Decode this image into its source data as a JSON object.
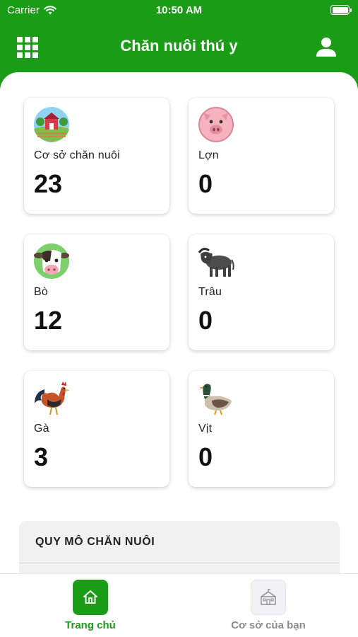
{
  "status_bar": {
    "carrier": "Carrier",
    "time": "10:50 AM"
  },
  "app_bar": {
    "title": "Chăn nuôi thú y",
    "menu_icon": "grid-icon",
    "profile_icon": "user-icon"
  },
  "stats": [
    {
      "label": "Cơ sở chăn nuôi",
      "count": "23",
      "icon": "farm-icon"
    },
    {
      "label": "Lợn",
      "count": "0",
      "icon": "pig-icon"
    },
    {
      "label": "Bò",
      "count": "12",
      "icon": "cow-icon"
    },
    {
      "label": "Trâu",
      "count": "0",
      "icon": "buffalo-icon"
    },
    {
      "label": "Gà",
      "count": "3",
      "icon": "rooster-icon"
    },
    {
      "label": "Vịt",
      "count": "0",
      "icon": "duck-icon"
    }
  ],
  "section": {
    "title": "QUY MÔ CHĂN NUÔI"
  },
  "tabs": [
    {
      "label": "Trang chủ",
      "icon": "home-icon",
      "active": true
    },
    {
      "label": "Cơ sở của bạn",
      "icon": "building-icon",
      "active": false
    }
  ],
  "colors": {
    "primary": "#1a9c17",
    "inactive_tab": "#8a8a8e"
  }
}
